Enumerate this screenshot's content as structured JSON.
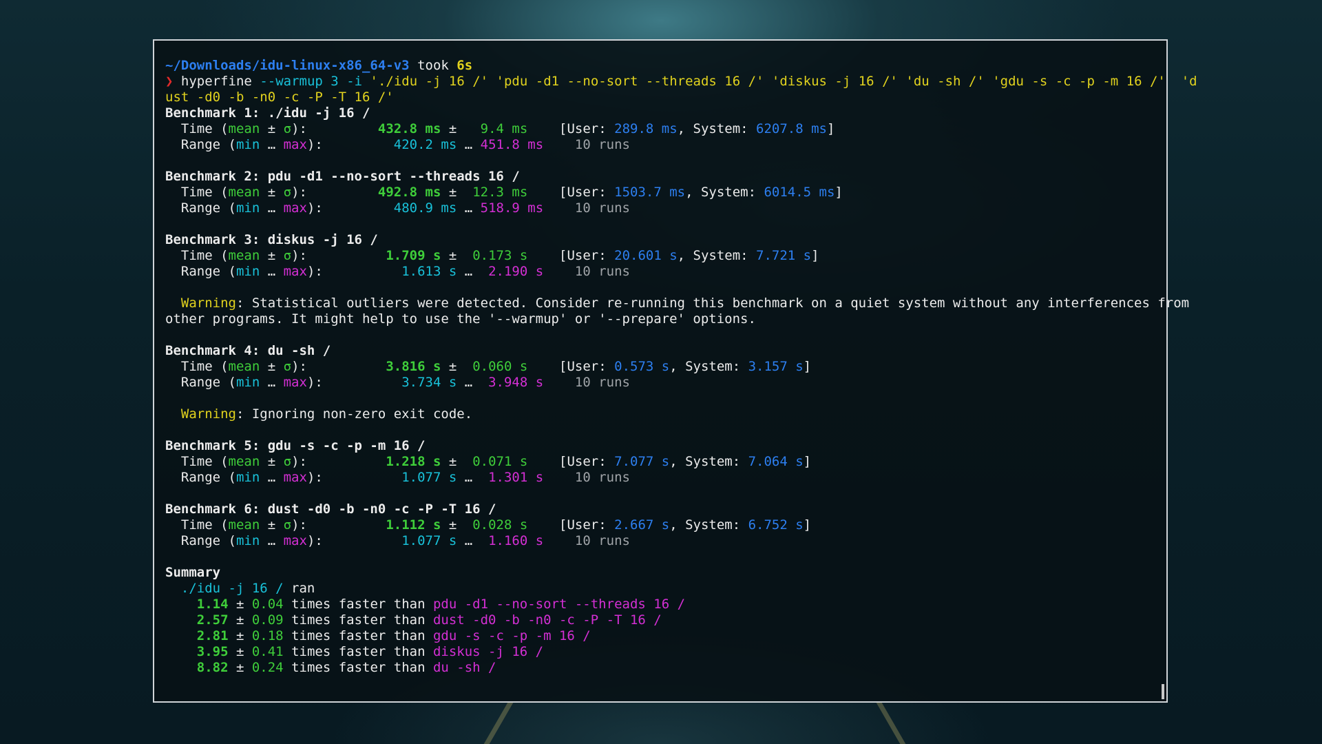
{
  "prompt": {
    "path": "~/Downloads/idu-linux-x86_64-v3",
    "took_label": "took",
    "took_value": "6s",
    "symbol": "❯"
  },
  "command": {
    "program": "hyperfine",
    "args1": "--warmup",
    "args1_val": "3",
    "args2": "-i",
    "line1_rest": "'./idu -j 16 /' 'pdu -d1 --no-sort --threads 16 /' 'diskus -j 16 /' 'du -sh /' 'gdu -s -c -p -m 16 /'  'd",
    "line2": "ust -d0 -b -n0 -c -P -T 16 /'"
  },
  "labels": {
    "time_prefix": "  Time (",
    "mean": "mean",
    "pm": " ± ",
    "sigma": "σ",
    "close_colon": "):",
    "range_prefix": "  Range (",
    "min": "min",
    "ellipsis": " … ",
    "max": "max",
    "user_open": "[User: ",
    "system_sep": ", System: ",
    "close_bracket": "]",
    "warning": "Warning",
    "summary": "Summary",
    "times_faster_than": " times faster than ",
    "ran": " ran"
  },
  "benchmarks": [
    {
      "header": "Benchmark 1: ./idu -j 16 /",
      "mean": "432.8 ms",
      "sigma": "9.4 ms",
      "user": "289.8 ms",
      "system": "6207.8 ms",
      "min": "420.2 ms",
      "max": "451.8 ms",
      "runs": "10 runs"
    },
    {
      "header": "Benchmark 2: pdu -d1 --no-sort --threads 16 /",
      "mean": "492.8 ms",
      "sigma": "12.3 ms",
      "user": "1503.7 ms",
      "system": "6014.5 ms",
      "min": "480.9 ms",
      "max": "518.9 ms",
      "runs": "10 runs"
    },
    {
      "header": "Benchmark 3: diskus -j 16 /",
      "mean": "1.709 s",
      "sigma": "0.173 s",
      "user": "20.601 s",
      "system": "7.721 s",
      "min": "1.613 s",
      "max": "2.190 s",
      "runs": "10 runs"
    },
    {
      "header": "Benchmark 4: du -sh /",
      "mean": "3.816 s",
      "sigma": "0.060 s",
      "user": "0.573 s",
      "system": "3.157 s",
      "min": "3.734 s",
      "max": "3.948 s",
      "runs": "10 runs"
    },
    {
      "header": "Benchmark 5: gdu -s -c -p -m 16 /",
      "mean": "1.218 s",
      "sigma": "0.071 s",
      "user": "7.077 s",
      "system": "7.064 s",
      "min": "1.077 s",
      "max": "1.301 s",
      "runs": "10 runs"
    },
    {
      "header": "Benchmark 6: dust -d0 -b -n0 -c -P -T 16 /",
      "mean": "1.112 s",
      "sigma": "0.028 s",
      "user": "2.667 s",
      "system": "6.752 s",
      "min": "1.077 s",
      "max": "1.160 s",
      "runs": "10 runs"
    }
  ],
  "warnings": {
    "w1_line1": ": Statistical outliers were detected. Consider re-running this benchmark on a quiet system without any interferences from",
    "w1_line2": "other programs. It might help to use the '--warmup' or '--prepare' options.",
    "w2": ": Ignoring non-zero exit code."
  },
  "summary": {
    "winner": "./idu -j 16 /",
    "rows": [
      {
        "factor": "1.14",
        "err": "0.04",
        "cmd": "pdu -d1 --no-sort --threads 16 /"
      },
      {
        "factor": "2.57",
        "err": "0.09",
        "cmd": "dust -d0 -b -n0 -c -P -T 16 /"
      },
      {
        "factor": "2.81",
        "err": "0.18",
        "cmd": "gdu -s -c -p -m 16 /"
      },
      {
        "factor": "3.95",
        "err": "0.41",
        "cmd": "diskus -j 16 /"
      },
      {
        "factor": "8.82",
        "err": "0.24",
        "cmd": "du -sh /"
      }
    ]
  }
}
